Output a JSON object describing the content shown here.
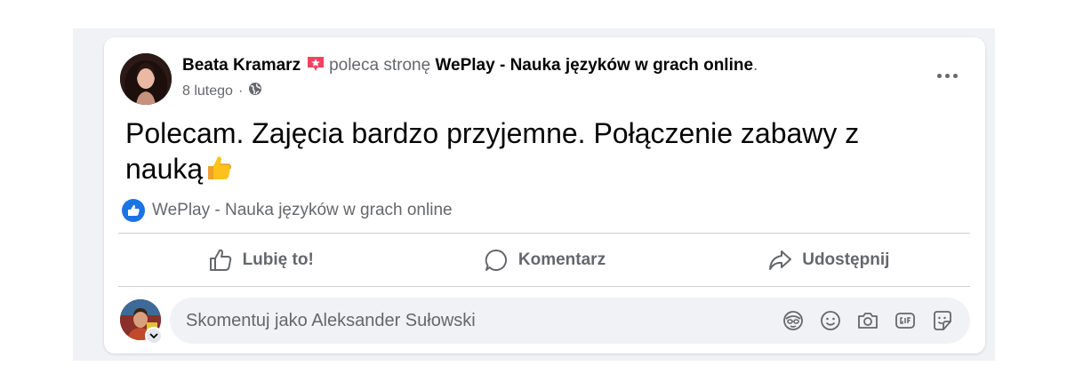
{
  "post": {
    "author": "Beata Kramarz",
    "verb": "poleca stronę",
    "page_name": "WePlay - Nauka języków w grach online",
    "trailing_dot": ".",
    "date": "8 lutego",
    "separator": "·",
    "privacy_icon": "globe-icon",
    "badge_icon": "star-recommend-icon",
    "text": "Polecam. Zajęcia bardzo przyjemne. Połączenie zabawy z nauką",
    "emoji": "thumbs-up-emoji",
    "recommendation_target": "WePlay - Nauka języków w grach online"
  },
  "actions": {
    "like_label": "Lubię to!",
    "comment_label": "Komentarz",
    "share_label": "Udostępnij"
  },
  "comment": {
    "placeholder": "Skomentuj jako Aleksander Sułowski",
    "tools": [
      "avatar-sticker-icon",
      "emoji-icon",
      "camera-icon",
      "gif-icon",
      "sticker-icon"
    ]
  },
  "colors": {
    "accent": "#1b74e4",
    "badge": "#f3425f",
    "muted_text": "#65676b",
    "background": "#f0f2f5"
  }
}
